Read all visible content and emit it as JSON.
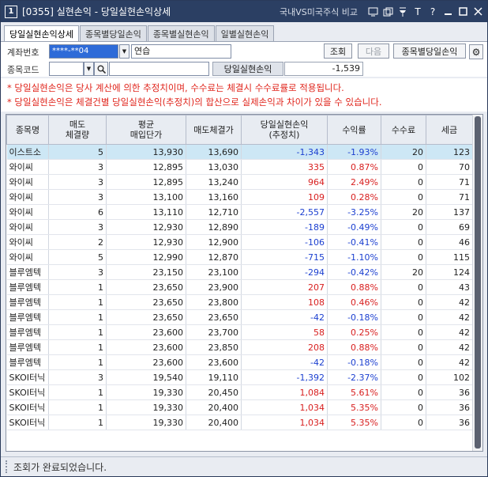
{
  "title": {
    "number": "1",
    "text": "[0355] 실현손익 - 당일실현손익상세",
    "link": "국내VS미국주식 비교"
  },
  "tabs": [
    "당일실현손익상세",
    "종목별당일손익",
    "종목별실현손익",
    "일별실현손익"
  ],
  "form": {
    "account_label": "계좌번호",
    "account_value": "****-**04",
    "account_name": "연습",
    "code_label": "종목코드",
    "query_button": "조회",
    "next_button": "다음",
    "by_stock_button": "종목별당일손익",
    "pl_label": "당일실현손익",
    "pl_value": "-1,539"
  },
  "notes": [
    "* 당일실현손익은 당사 계산에 의한 추정치이며, 수수료는 체결시 수수료률로 적용됩니다.",
    "* 당일실현손익은 체결건별 당일실현손익(추정치)의 합산으로 실제손익과 차이가 있을 수 있습니다."
  ],
  "table": {
    "headers": [
      [
        "종목명"
      ],
      [
        "매도",
        "체결량"
      ],
      [
        "평균",
        "매입단가"
      ],
      [
        "매도체결가"
      ],
      [
        "당일실현손익",
        "(추정치)"
      ],
      [
        "수익률"
      ],
      [
        "수수료"
      ],
      [
        "세금"
      ]
    ],
    "rows": [
      {
        "name": "이스트소",
        "qty": "5",
        "avg": "13,930",
        "sell": "13,690",
        "pl": "-1,343",
        "rate": "-1.93%",
        "fee": "20",
        "tax": "123",
        "sign": "neg",
        "selected": true
      },
      {
        "name": "와이씨",
        "qty": "3",
        "avg": "12,895",
        "sell": "13,030",
        "pl": "335",
        "rate": "0.87%",
        "fee": "0",
        "tax": "70",
        "sign": "pos"
      },
      {
        "name": "와이씨",
        "qty": "3",
        "avg": "12,895",
        "sell": "13,240",
        "pl": "964",
        "rate": "2.49%",
        "fee": "0",
        "tax": "71",
        "sign": "pos"
      },
      {
        "name": "와이씨",
        "qty": "3",
        "avg": "13,100",
        "sell": "13,160",
        "pl": "109",
        "rate": "0.28%",
        "fee": "0",
        "tax": "71",
        "sign": "pos"
      },
      {
        "name": "와이씨",
        "qty": "6",
        "avg": "13,110",
        "sell": "12,710",
        "pl": "-2,557",
        "rate": "-3.25%",
        "fee": "20",
        "tax": "137",
        "sign": "neg"
      },
      {
        "name": "와이씨",
        "qty": "3",
        "avg": "12,930",
        "sell": "12,890",
        "pl": "-189",
        "rate": "-0.49%",
        "fee": "0",
        "tax": "69",
        "sign": "neg"
      },
      {
        "name": "와이씨",
        "qty": "2",
        "avg": "12,930",
        "sell": "12,900",
        "pl": "-106",
        "rate": "-0.41%",
        "fee": "0",
        "tax": "46",
        "sign": "neg"
      },
      {
        "name": "와이씨",
        "qty": "5",
        "avg": "12,990",
        "sell": "12,870",
        "pl": "-715",
        "rate": "-1.10%",
        "fee": "0",
        "tax": "115",
        "sign": "neg"
      },
      {
        "name": "블루엠텍",
        "qty": "3",
        "avg": "23,150",
        "sell": "23,100",
        "pl": "-294",
        "rate": "-0.42%",
        "fee": "20",
        "tax": "124",
        "sign": "neg"
      },
      {
        "name": "블루엠텍",
        "qty": "1",
        "avg": "23,650",
        "sell": "23,900",
        "pl": "207",
        "rate": "0.88%",
        "fee": "0",
        "tax": "43",
        "sign": "pos"
      },
      {
        "name": "블루엠텍",
        "qty": "1",
        "avg": "23,650",
        "sell": "23,800",
        "pl": "108",
        "rate": "0.46%",
        "fee": "0",
        "tax": "42",
        "sign": "pos"
      },
      {
        "name": "블루엠텍",
        "qty": "1",
        "avg": "23,650",
        "sell": "23,650",
        "pl": "-42",
        "rate": "-0.18%",
        "fee": "0",
        "tax": "42",
        "sign": "neg"
      },
      {
        "name": "블루엠텍",
        "qty": "1",
        "avg": "23,600",
        "sell": "23,700",
        "pl": "58",
        "rate": "0.25%",
        "fee": "0",
        "tax": "42",
        "sign": "pos"
      },
      {
        "name": "블루엠텍",
        "qty": "1",
        "avg": "23,600",
        "sell": "23,850",
        "pl": "208",
        "rate": "0.88%",
        "fee": "0",
        "tax": "42",
        "sign": "pos"
      },
      {
        "name": "블루엠텍",
        "qty": "1",
        "avg": "23,600",
        "sell": "23,600",
        "pl": "-42",
        "rate": "-0.18%",
        "fee": "0",
        "tax": "42",
        "sign": "neg"
      },
      {
        "name": "SKOI터닉",
        "qty": "3",
        "avg": "19,540",
        "sell": "19,110",
        "pl": "-1,392",
        "rate": "-2.37%",
        "fee": "0",
        "tax": "102",
        "sign": "neg"
      },
      {
        "name": "SKOI터닉",
        "qty": "1",
        "avg": "19,330",
        "sell": "20,450",
        "pl": "1,084",
        "rate": "5.61%",
        "fee": "0",
        "tax": "36",
        "sign": "pos"
      },
      {
        "name": "SKOI터닉",
        "qty": "1",
        "avg": "19,330",
        "sell": "20,400",
        "pl": "1,034",
        "rate": "5.35%",
        "fee": "0",
        "tax": "36",
        "sign": "pos"
      },
      {
        "name": "SKOI터닉",
        "qty": "1",
        "avg": "19,330",
        "sell": "20,400",
        "pl": "1,034",
        "rate": "5.35%",
        "fee": "0",
        "tax": "36",
        "sign": "pos"
      }
    ]
  },
  "status": "조회가 완료되었습니다.",
  "colors": {
    "title_bar": "#2b3f63",
    "negative": "#1b3fd0",
    "positive": "#d82020",
    "note": "#e0241b",
    "selected_row": "#cde7f5"
  },
  "icons": [
    "window-number-icon",
    "screen-icon",
    "copy-icon",
    "pin-icon",
    "text-icon",
    "help-icon",
    "minimize-icon",
    "maximize-icon",
    "close-icon",
    "dropdown-icon",
    "search-icon",
    "gear-icon"
  ]
}
